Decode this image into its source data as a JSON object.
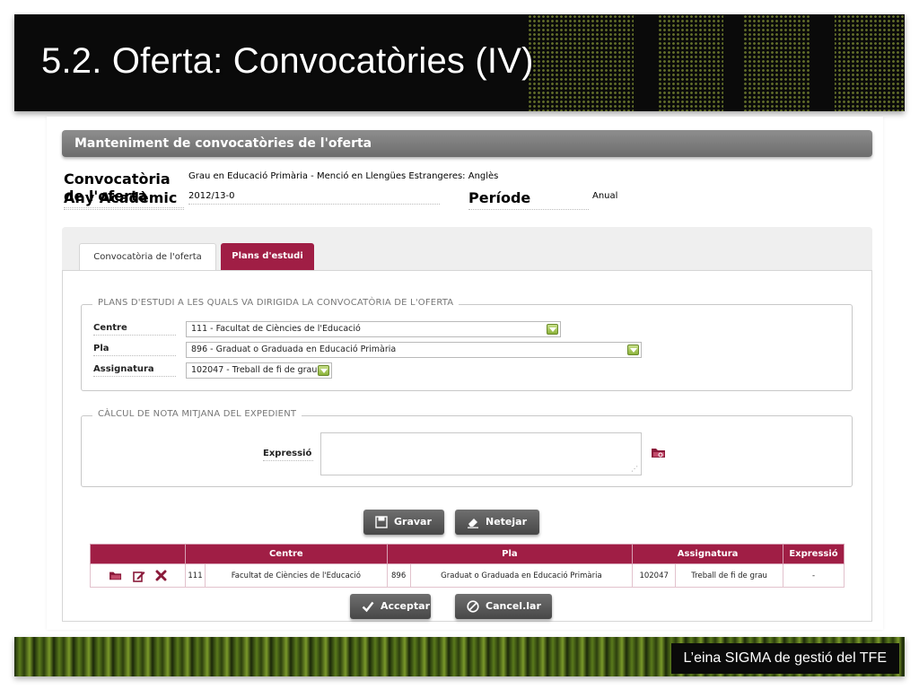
{
  "slide": {
    "title": "5.2. Oferta: Convocatòries (IV)",
    "footer_text": "L’eina SIGMA de gestió del TFE"
  },
  "form": {
    "heading": "Manteniment de convocatòries de l'oferta",
    "info": {
      "convocatoria_label": "Convocatòria de l'oferta",
      "convocatoria_value": "Grau en Educació Primària - Menció en Llengües Estrangeres: Anglès",
      "any_label": "Any Acadèmic",
      "any_value": "2012/13-0",
      "periode_label": "Període",
      "periode_value": "Anual"
    },
    "tabs": [
      {
        "label": "Convocatòria de l'oferta",
        "active": false
      },
      {
        "label": "Plans d'estudi",
        "active": true
      }
    ],
    "plans_legend": "PLANS D'ESTUDI A LES QUALS VA DIRIGIDA LA CONVOCATÒRIA DE L'OFERTA",
    "centre_label": "Centre",
    "centre_value": "111 - Facultat de Ciències de l'Educació",
    "pla_label": "Pla",
    "pla_value": "896 - Graduat o Graduada en Educació Primària",
    "assignatura_label": "Assignatura",
    "assignatura_value": "102047 - Treball de fi de grau",
    "calcul_legend": "CÀLCUL DE NOTA MITJANA DEL EXPEDIENT",
    "expressio_label": "Expressió",
    "expressio_value": "",
    "gravar_label": "Gravar",
    "netejar_label": "Netejar",
    "acceptar_label": "Acceptar",
    "cancellar_label": "Cancel.lar"
  },
  "table": {
    "headers": [
      "",
      "Centre",
      "Pla",
      "Assignatura",
      "Expressió"
    ],
    "rows": [
      {
        "centre_code": "111",
        "centre_name": "Facultat de Ciències de l'Educació",
        "pla_code": "896",
        "pla_name": "Graduat o Graduada en Educació Primària",
        "assig_code": "102047",
        "assig_name": "Treball de fi de grau",
        "expressio": "-"
      }
    ]
  },
  "colors": {
    "accent": "#a01e45",
    "header_grey": "#7a7a7a",
    "button_grey": "#555555",
    "banner_black": "#0a0a0a",
    "footer_green": "#5a7a1c"
  },
  "icons": [
    "folder-icon",
    "edit-icon",
    "delete-icon",
    "save-icon",
    "eraser-icon",
    "check-icon",
    "cancel-icon",
    "dropdown-icon"
  ]
}
